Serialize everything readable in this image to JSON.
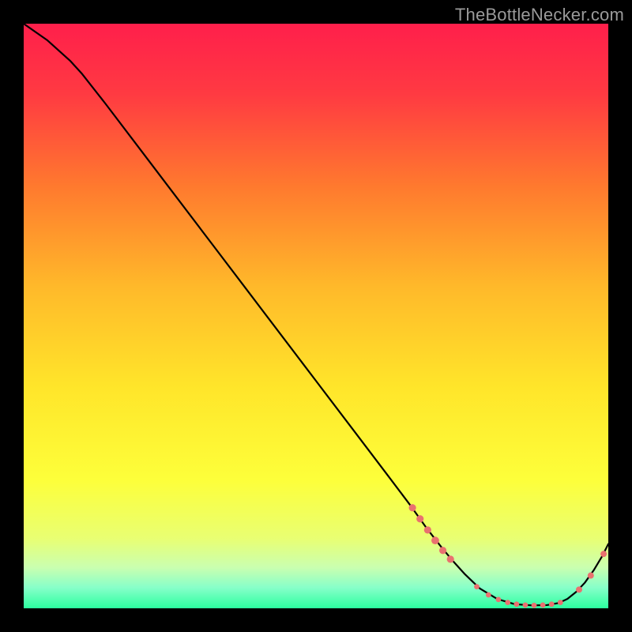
{
  "watermark": "TheBottleNecker.com",
  "chart_data": {
    "type": "line",
    "title": "",
    "xlabel": "",
    "ylabel": "",
    "xlim": [
      0,
      100
    ],
    "ylim": [
      0,
      100
    ],
    "grid": false,
    "background_gradient": {
      "stops": [
        {
          "pos": 0.0,
          "color": "#ff1f4b"
        },
        {
          "pos": 0.12,
          "color": "#ff3a42"
        },
        {
          "pos": 0.28,
          "color": "#ff7a2e"
        },
        {
          "pos": 0.45,
          "color": "#ffb92a"
        },
        {
          "pos": 0.62,
          "color": "#ffe52a"
        },
        {
          "pos": 0.78,
          "color": "#fdff3a"
        },
        {
          "pos": 0.88,
          "color": "#e9ff72"
        },
        {
          "pos": 0.93,
          "color": "#caffb0"
        },
        {
          "pos": 0.965,
          "color": "#86ffc9"
        },
        {
          "pos": 1.0,
          "color": "#2bff9f"
        }
      ]
    },
    "series": [
      {
        "name": "curve",
        "stroke": "#000000",
        "stroke_width": 2.2,
        "x": [
          0,
          4,
          8,
          10,
          14,
          20,
          26,
          32,
          38,
          44,
          50,
          56,
          62,
          66,
          69,
          71.5,
          73.5,
          75.5,
          78,
          81,
          84,
          87,
          89.5,
          91.5,
          93,
          94.5,
          96,
          97.5,
          99,
          100
        ],
        "y": [
          100,
          97.2,
          93.6,
          91.4,
          86.3,
          78.4,
          70.5,
          62.6,
          54.7,
          46.8,
          38.9,
          31.0,
          23.1,
          17.8,
          13.6,
          10.4,
          8.0,
          5.8,
          3.4,
          1.6,
          0.7,
          0.5,
          0.55,
          0.9,
          1.6,
          2.8,
          4.4,
          6.5,
          9.0,
          11.0
        ]
      }
    ],
    "markers": [
      {
        "name": "m1",
        "x": 66.5,
        "y": 17.2,
        "r": 4.6,
        "color": "#e9716f"
      },
      {
        "name": "m2",
        "x": 67.8,
        "y": 15.3,
        "r": 4.6,
        "color": "#e9716f"
      },
      {
        "name": "m3",
        "x": 69.1,
        "y": 13.4,
        "r": 4.6,
        "color": "#e9716f"
      },
      {
        "name": "m4",
        "x": 70.4,
        "y": 11.6,
        "r": 4.9,
        "color": "#e9716f"
      },
      {
        "name": "m5",
        "x": 71.7,
        "y": 9.9,
        "r": 4.6,
        "color": "#e9716f"
      },
      {
        "name": "m6",
        "x": 73.0,
        "y": 8.4,
        "r": 4.6,
        "color": "#e9716f"
      },
      {
        "name": "m7",
        "x": 77.5,
        "y": 3.7,
        "r": 3.4,
        "color": "#e9716f"
      },
      {
        "name": "m8",
        "x": 79.5,
        "y": 2.3,
        "r": 3.4,
        "color": "#e9716f"
      },
      {
        "name": "m9",
        "x": 81.2,
        "y": 1.5,
        "r": 3.4,
        "color": "#e9716f"
      },
      {
        "name": "m10",
        "x": 82.8,
        "y": 1.0,
        "r": 3.4,
        "color": "#e9716f"
      },
      {
        "name": "m11",
        "x": 84.3,
        "y": 0.7,
        "r": 3.4,
        "color": "#e9716f"
      },
      {
        "name": "m12",
        "x": 85.8,
        "y": 0.55,
        "r": 3.4,
        "color": "#e9716f"
      },
      {
        "name": "m13",
        "x": 87.3,
        "y": 0.5,
        "r": 3.4,
        "color": "#e9716f"
      },
      {
        "name": "m14",
        "x": 88.8,
        "y": 0.55,
        "r": 3.4,
        "color": "#e9716f"
      },
      {
        "name": "m15",
        "x": 90.3,
        "y": 0.7,
        "r": 3.4,
        "color": "#e9716f"
      },
      {
        "name": "m16",
        "x": 91.8,
        "y": 1.0,
        "r": 3.4,
        "color": "#e9716f"
      },
      {
        "name": "m17",
        "x": 95.0,
        "y": 3.2,
        "r": 4.0,
        "color": "#e9716f"
      },
      {
        "name": "m18",
        "x": 97.0,
        "y": 5.6,
        "r": 4.0,
        "color": "#e9716f"
      },
      {
        "name": "m19",
        "x": 99.2,
        "y": 9.3,
        "r": 4.0,
        "color": "#e9716f"
      }
    ]
  }
}
